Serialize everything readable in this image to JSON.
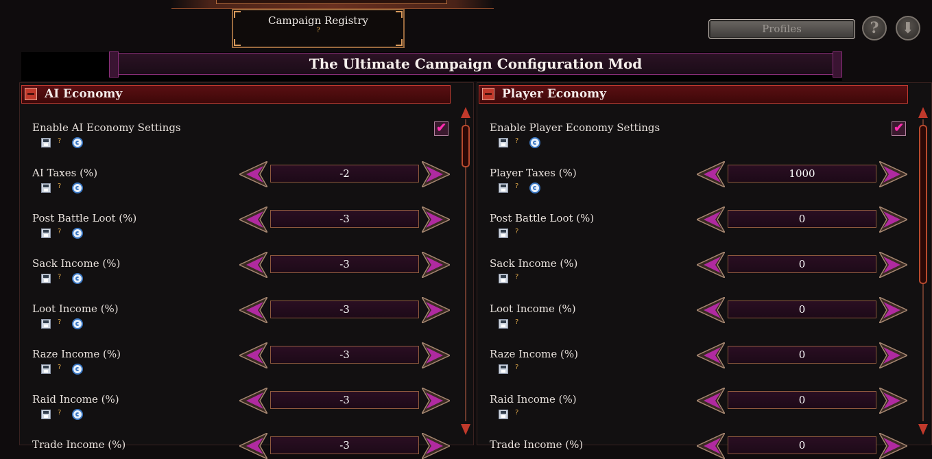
{
  "registry": {
    "title": "Campaign Registry",
    "help": "?"
  },
  "toolbar": {
    "profiles_label": "Profiles",
    "help_label": "?",
    "download_label": "⬇"
  },
  "banner": {
    "title": "The Ultimate Campaign Configuration Mod"
  },
  "colors": {
    "accent": "#c0392b",
    "checkbox": "#ff2db0",
    "banner_border": "#8a2e7a"
  },
  "left_panel": {
    "title": "AI Economy",
    "toggle": {
      "label": "Enable AI Economy Settings",
      "checked": true
    },
    "rows": [
      {
        "label": "AI Taxes (%)",
        "value": "-2"
      },
      {
        "label": "Post Battle Loot (%)",
        "value": "-3"
      },
      {
        "label": "Sack Income (%)",
        "value": "-3"
      },
      {
        "label": "Loot Income (%)",
        "value": "-3"
      },
      {
        "label": "Raze Income (%)",
        "value": "-3"
      },
      {
        "label": "Raid Income (%)",
        "value": "-3"
      },
      {
        "label": "Trade Income (%)",
        "value": "-3"
      }
    ]
  },
  "right_panel": {
    "title": "Player Economy",
    "toggle": {
      "label": "Enable Player Economy Settings",
      "checked": true
    },
    "rows": [
      {
        "label": "Player Taxes (%)",
        "value": "1000"
      },
      {
        "label": "Post Battle Loot (%)",
        "value": "0"
      },
      {
        "label": "Sack Income (%)",
        "value": "0"
      },
      {
        "label": "Loot Income (%)",
        "value": "0"
      },
      {
        "label": "Raze Income (%)",
        "value": "0"
      },
      {
        "label": "Raid Income (%)",
        "value": "0"
      },
      {
        "label": "Trade Income (%)",
        "value": "0"
      }
    ]
  },
  "icons": {
    "save": "save-icon",
    "help": "?",
    "reset": "reset-icon",
    "check": "✔"
  }
}
